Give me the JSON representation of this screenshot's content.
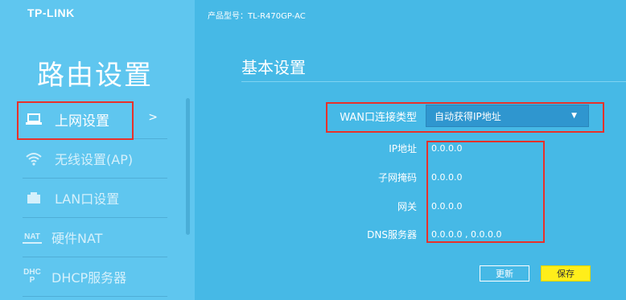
{
  "brand": {
    "logo": "TP-LINK"
  },
  "header": {
    "model": "产品型号：TL-R470GP-AC"
  },
  "sidebar": {
    "title": "路由设置",
    "items": [
      {
        "label": "上网设置",
        "icon": "laptop-icon",
        "active": true,
        "chevron": ">"
      },
      {
        "label": "无线设置(AP)",
        "icon": "wifi-icon",
        "active": false
      },
      {
        "label": "LAN口设置",
        "icon": "lan-port-icon",
        "active": false
      },
      {
        "label": "硬件NAT",
        "icon": "nat-icon",
        "icon_text": "NAT",
        "active": false
      },
      {
        "label": "DHCP服务器",
        "icon": "dhcp-icon",
        "icon_text": "DHCP",
        "active": false
      }
    ]
  },
  "main": {
    "title": "基本设置",
    "wan_type": {
      "label": "WAN口连接类型",
      "value": "自动获得IP地址"
    },
    "fields": [
      {
        "label": "IP地址",
        "value": "0.0.0.0"
      },
      {
        "label": "子网掩码",
        "value": "0.0.0.0"
      },
      {
        "label": "网关",
        "value": "0.0.0.0"
      },
      {
        "label": "DNS服务器",
        "value": "0.0.0.0 , 0.0.0.0"
      }
    ],
    "buttons": {
      "refresh": "更新",
      "save": "保存"
    }
  },
  "colors": {
    "background": "#46b9e6",
    "sidebar": "#5fc6ef",
    "highlight_box": "#e8312a",
    "save_button": "#ffee1a"
  }
}
